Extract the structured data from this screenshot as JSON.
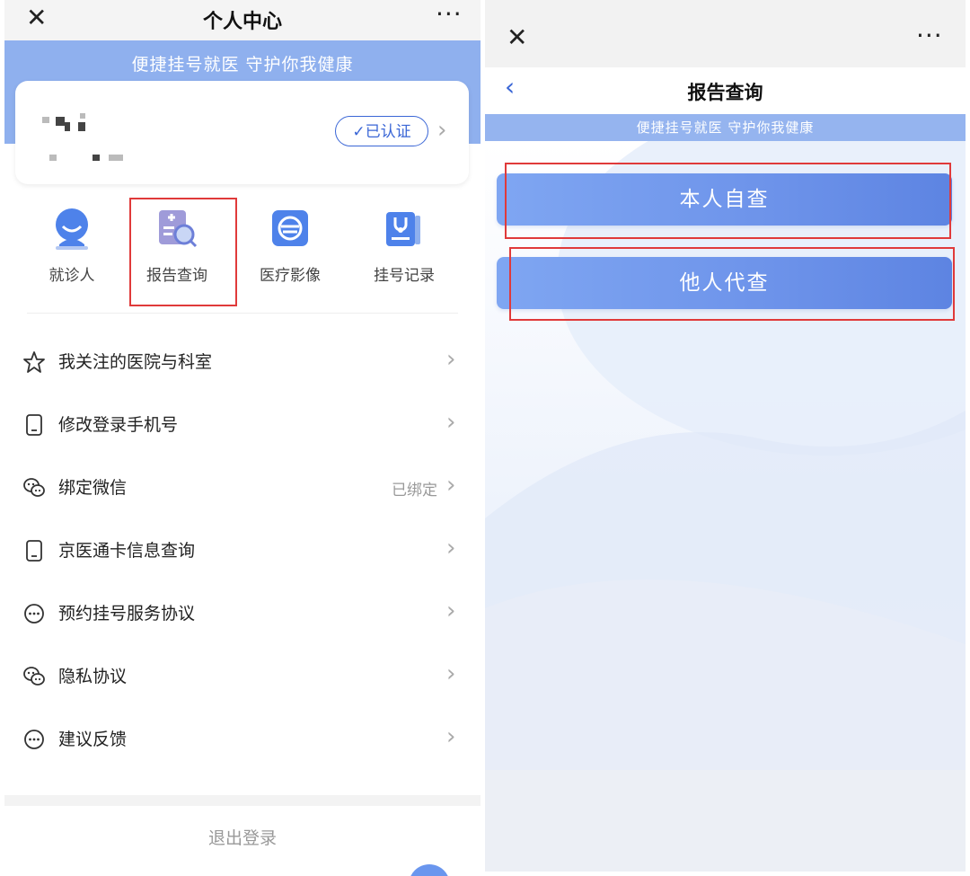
{
  "left": {
    "title": "个人中心",
    "slogan": "便捷挂号就医 守护你我健康",
    "user_card": {
      "verified_label": "✓已认证"
    },
    "quick_actions": [
      {
        "label": "就诊人",
        "icon": "patient-icon"
      },
      {
        "label": "报告查询",
        "icon": "report-search-icon"
      },
      {
        "label": "医疗影像",
        "icon": "medical-imaging-icon"
      },
      {
        "label": "挂号记录",
        "icon": "registration-record-icon"
      }
    ],
    "menu": [
      {
        "label": "我关注的医院与科室",
        "icon": "star-icon",
        "value": ""
      },
      {
        "label": "修改登录手机号",
        "icon": "phone-icon",
        "value": ""
      },
      {
        "label": "绑定微信",
        "icon": "wechat-icon",
        "value": "已绑定"
      },
      {
        "label": "京医通卡信息查询",
        "icon": "card-icon",
        "value": ""
      },
      {
        "label": "预约挂号服务协议",
        "icon": "chat-dots-icon",
        "value": ""
      },
      {
        "label": "隐私协议",
        "icon": "wechat-icon",
        "value": ""
      },
      {
        "label": "建议反馈",
        "icon": "chat-dots-icon",
        "value": ""
      }
    ],
    "logout_label": "退出登录"
  },
  "right": {
    "title": "报告查询",
    "slogan": "便捷挂号就医 守护你我健康",
    "buttons": [
      {
        "label": "本人自查"
      },
      {
        "label": "他人代查"
      }
    ]
  },
  "colors": {
    "accent": "#3a66d6",
    "banner": "#8fb0ee",
    "highlight": "#e03a3a"
  }
}
